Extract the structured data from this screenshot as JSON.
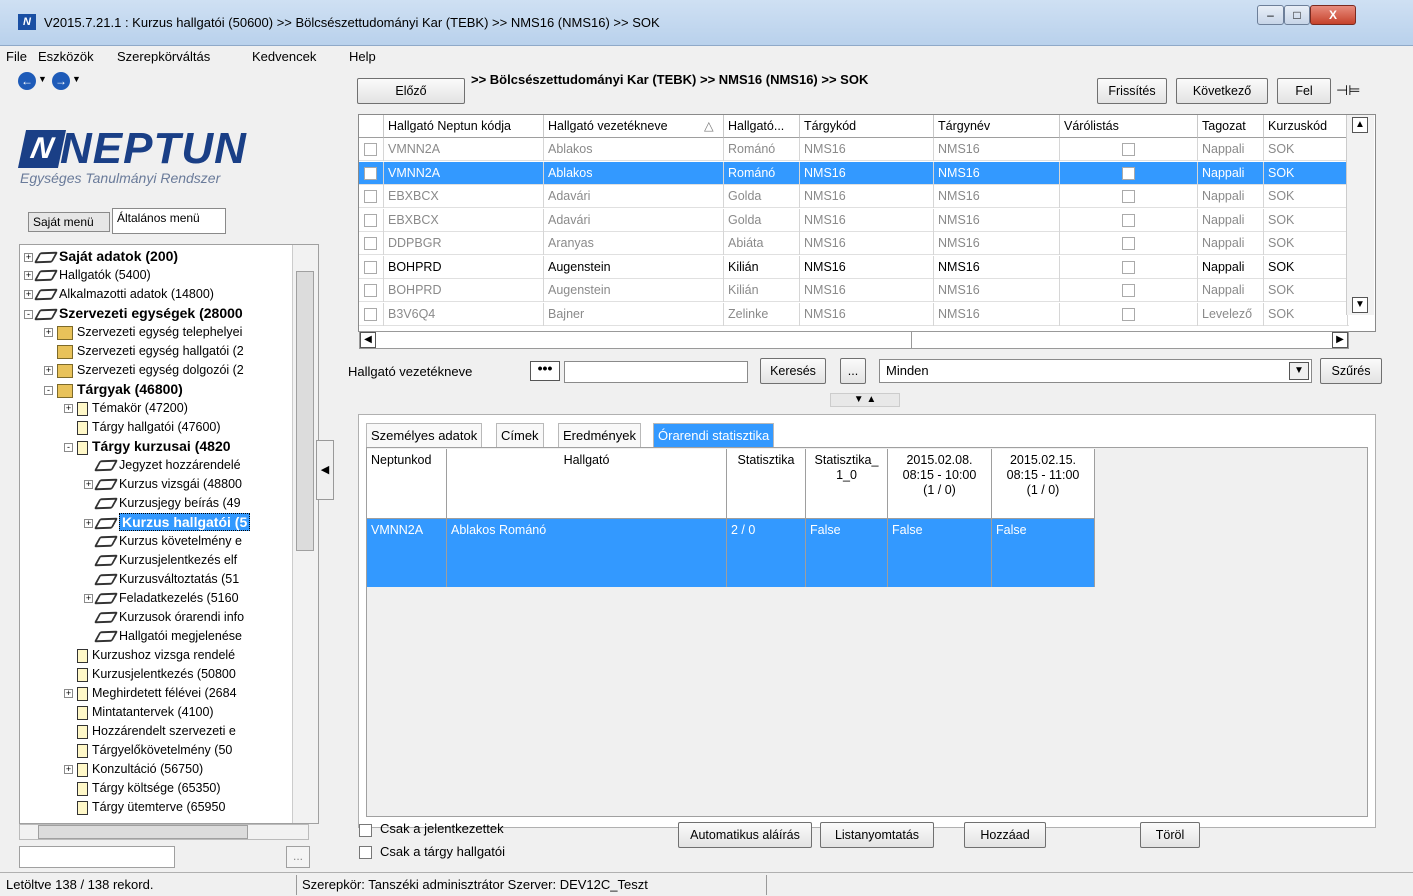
{
  "window": {
    "title": "V2015.7.21.1 : Kurzus hallgatói (50600)  >> Bölcsészettudományi Kar (TEBK) >> NMS16 (NMS16) >> SOK",
    "minimize": "–",
    "maximize": "□",
    "close": "X"
  },
  "menubar": [
    "File",
    "Eszközök",
    "Szerepkörváltás",
    "Kedvencek",
    "Help"
  ],
  "nav": {
    "back": "←",
    "forward": "→"
  },
  "logo": {
    "title": "NEPTUN",
    "mark": "N",
    "subtitle": "Egységes Tanulmányi Rendszer"
  },
  "left_tabs": {
    "sajat": "Saját menü",
    "altalanos": "Általános menü"
  },
  "tree": [
    {
      "label": "Saját adatok (200)",
      "indent": 0,
      "icon": "node",
      "expander": "+",
      "bold": true
    },
    {
      "label": "Hallgatók (5400)",
      "indent": 0,
      "icon": "node",
      "expander": "+",
      "bold": false
    },
    {
      "label": "Alkalmazotti adatok (14800)",
      "indent": 0,
      "icon": "node",
      "expander": "+",
      "bold": false
    },
    {
      "label": "Szervezeti egységek (28000",
      "indent": 0,
      "icon": "node",
      "expander": "-",
      "bold": true
    },
    {
      "label": "Szervezeti egység telephelyei",
      "indent": 1,
      "icon": "folder",
      "expander": "+",
      "bold": false
    },
    {
      "label": "Szervezeti egység hallgatói (2",
      "indent": 1,
      "icon": "folder",
      "expander": "",
      "bold": false
    },
    {
      "label": "Szervezeti egység dolgozói (2",
      "indent": 1,
      "icon": "folder",
      "expander": "+",
      "bold": false
    },
    {
      "label": "Tárgyak (46800)",
      "indent": 1,
      "icon": "folder",
      "expander": "-",
      "bold": true
    },
    {
      "label": "Témakör (47200)",
      "indent": 2,
      "icon": "page",
      "expander": "+",
      "bold": false
    },
    {
      "label": "Tárgy hallgatói (47600)",
      "indent": 2,
      "icon": "page",
      "expander": "",
      "bold": false
    },
    {
      "label": "Tárgy kurzusai (4820",
      "indent": 2,
      "icon": "page",
      "expander": "-",
      "bold": true
    },
    {
      "label": "Jegyzet hozzárendelé",
      "indent": 3,
      "icon": "node",
      "expander": "",
      "bold": false
    },
    {
      "label": "Kurzus vizsgái (48800",
      "indent": 3,
      "icon": "node",
      "expander": "+",
      "bold": false
    },
    {
      "label": "Kurzusjegy beírás (49",
      "indent": 3,
      "icon": "node",
      "expander": "",
      "bold": false
    },
    {
      "label": "Kurzus hallgatói (5",
      "indent": 3,
      "icon": "node",
      "expander": "+",
      "bold": true,
      "selected": true
    },
    {
      "label": "Kurzus követelmény e",
      "indent": 3,
      "icon": "node",
      "expander": "",
      "bold": false
    },
    {
      "label": "Kurzusjelentkezés elf",
      "indent": 3,
      "icon": "node",
      "expander": "",
      "bold": false
    },
    {
      "label": "Kurzusváltoztatás (51",
      "indent": 3,
      "icon": "node",
      "expander": "",
      "bold": false
    },
    {
      "label": "Feladatkezelés (5160",
      "indent": 3,
      "icon": "node",
      "expander": "+",
      "bold": false
    },
    {
      "label": "Kurzusok órarendi info",
      "indent": 3,
      "icon": "node",
      "expander": "",
      "bold": false
    },
    {
      "label": "Hallgatói megjelenése",
      "indent": 3,
      "icon": "node",
      "expander": "",
      "bold": false
    },
    {
      "label": "Kurzushoz vizsga rendelé",
      "indent": 2,
      "icon": "page",
      "expander": "",
      "bold": false
    },
    {
      "label": "Kurzusjelentkezés (50800",
      "indent": 2,
      "icon": "page",
      "expander": "",
      "bold": false
    },
    {
      "label": "Meghirdetett félévei (2684",
      "indent": 2,
      "icon": "page",
      "expander": "+",
      "bold": false
    },
    {
      "label": "Mintatantervek (4100)",
      "indent": 2,
      "icon": "page",
      "expander": "",
      "bold": false
    },
    {
      "label": "Hozzárendelt szervezeti e",
      "indent": 2,
      "icon": "page",
      "expander": "",
      "bold": false
    },
    {
      "label": "Tárgyelőkövetelmény (50",
      "indent": 2,
      "icon": "page",
      "expander": "",
      "bold": false
    },
    {
      "label": "Konzultáció (56750)",
      "indent": 2,
      "icon": "page",
      "expander": "+",
      "bold": false
    },
    {
      "label": "Tárgy költsége (65350)",
      "indent": 2,
      "icon": "page",
      "expander": "",
      "bold": false
    },
    {
      "label": "Tárgy ütemterve (65950",
      "indent": 2,
      "icon": "page",
      "expander": "",
      "bold": false
    }
  ],
  "left_search_btn": "...",
  "toolbar": {
    "prev": "Előző",
    "breadcrumb": ">> Bölcsészettudományi Kar (TEBK) >> NMS16 (NMS16) >> SOK",
    "refresh": "Frissítés",
    "next": "Következő",
    "up": "Fel",
    "pin": "⊣⊨"
  },
  "grid": {
    "columns": [
      "Hallgató Neptun kódja",
      "Hallgató vezetékneve",
      "Hallgató...",
      "Tárgykód",
      "Tárgynév",
      "Várólistás",
      "Tagozat",
      "Kurzuskód"
    ],
    "sort_indicator": "△",
    "rows": [
      {
        "code": "VMNN2A",
        "last": "Ablakos",
        "first": "Románó",
        "subj_code": "NMS16",
        "subj_name": "NMS16",
        "mode": "Nappali",
        "course": "SOK",
        "style": "dim"
      },
      {
        "code": "VMNN2A",
        "last": "Ablakos",
        "first": "Románó",
        "subj_code": "NMS16",
        "subj_name": "NMS16",
        "mode": "Nappali",
        "course": "SOK",
        "style": "sel"
      },
      {
        "code": "EBXBCX",
        "last": "Adavári",
        "first": "Golda",
        "subj_code": "NMS16",
        "subj_name": "NMS16",
        "mode": "Nappali",
        "course": "SOK",
        "style": "dim"
      },
      {
        "code": "EBXBCX",
        "last": "Adavári",
        "first": "Golda",
        "subj_code": "NMS16",
        "subj_name": "NMS16",
        "mode": "Nappali",
        "course": "SOK",
        "style": "dim"
      },
      {
        "code": "DDPBGR",
        "last": "Aranyas",
        "first": "Abiáta",
        "subj_code": "NMS16",
        "subj_name": "NMS16",
        "mode": "Nappali",
        "course": "SOK",
        "style": "dim"
      },
      {
        "code": "BOHPRD",
        "last": "Augenstein",
        "first": "Kilián",
        "subj_code": "NMS16",
        "subj_name": "NMS16",
        "mode": "Nappali",
        "course": "SOK",
        "style": "normal"
      },
      {
        "code": "BOHPRD",
        "last": "Augenstein",
        "first": "Kilián",
        "subj_code": "NMS16",
        "subj_name": "NMS16",
        "mode": "Nappali",
        "course": "SOK",
        "style": "dim"
      },
      {
        "code": "B3V6Q4",
        "last": "Bajner",
        "first": "Zelinke",
        "subj_code": "NMS16",
        "subj_name": "NMS16",
        "mode": "Levelező",
        "course": "SOK",
        "style": "dim"
      }
    ]
  },
  "filter": {
    "label": "Hallgató vezetékneve",
    "dots": "•••",
    "value": "",
    "search": "Keresés",
    "ellipsis": "...",
    "selected": "Minden",
    "apply": "Szűrés",
    "split_arrows": "▼ ▲"
  },
  "detail_tabs": [
    "Személyes adatok",
    "Címek",
    "Eredmények",
    "Órarendi statisztika"
  ],
  "detail_grid": {
    "columns": [
      "Neptunkod",
      "Hallgató",
      "Statisztika",
      "Statisztika_\n1_0",
      "2015.02.08.\n08:15 - 10:00\n(1 / 0)",
      "2015.02.15.\n08:15 - 11:00\n(1 / 0)"
    ],
    "row": [
      "VMNN2A",
      "Ablakos Románó",
      "2 / 0",
      "False",
      "False",
      "False"
    ]
  },
  "bottom": {
    "only_applied": "Csak a jelentkezettek",
    "only_subject": "Csak a tárgy hallgatói",
    "auto_sign": "Automatikus aláírás",
    "list_print": "Listanyomtatás",
    "add": "Hozzáad",
    "delete": "Töröl"
  },
  "status": {
    "records": "Letöltve 138 / 138 rekord.",
    "role_server": "Szerepkör: Tanszéki adminisztrátor  Szerver: DEV12C_Teszt"
  },
  "colors": {
    "selection": "#3399ff",
    "title_bar": "#b9d1ec",
    "logo": "#1a3f86"
  }
}
